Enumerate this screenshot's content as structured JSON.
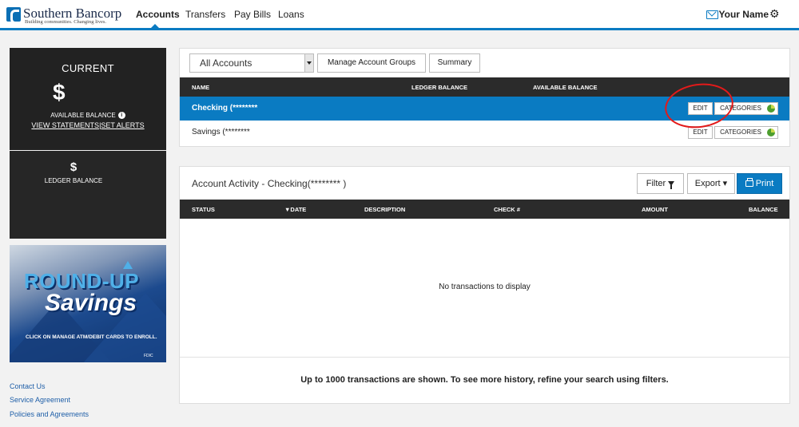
{
  "brand": {
    "name": "Southern Bancorp",
    "tagline": "Building communities. Changing lives."
  },
  "nav": {
    "items": [
      "Accounts",
      "Transfers",
      "Pay Bills",
      "Loans"
    ],
    "active": "Accounts",
    "user_name": "Your Name"
  },
  "sidebar": {
    "current_label": "CURRENT",
    "available_amount": "$",
    "available_label": "AVAILABLE BALANCE",
    "view_statements": "VIEW STATEMENTS",
    "separator": "|",
    "set_alerts": "SET ALERTS",
    "ledger_amount": "$",
    "ledger_label": "LEDGER BALANCE",
    "promo": {
      "title_line1": "ROUND-UP",
      "title_line2": "Savings",
      "cta": "CLICK ON MANAGE ATM/DEBIT CARDS TO ENROLL.",
      "fdic": "FDIC"
    },
    "footer_links": [
      "Contact Us",
      "Service Agreement",
      "Policies and Agreements"
    ]
  },
  "accounts": {
    "filter_select": "All Accounts",
    "manage_groups": "Manage Account Groups",
    "summary": "Summary",
    "columns": [
      "NAME",
      "LEDGER BALANCE",
      "AVAILABLE BALANCE"
    ],
    "rows": [
      {
        "name": "Checking (********",
        "selected": true,
        "edit": "EDIT",
        "categories": "CATEGORIES"
      },
      {
        "name": "Savings (********",
        "selected": false,
        "edit": "EDIT",
        "categories": "CATEGORIES"
      }
    ]
  },
  "activity": {
    "title": "Account Activity - Checking(********        )",
    "filter": "Filter",
    "export": "Export",
    "export_caret": "▾",
    "print": "Print",
    "columns": [
      "STATUS",
      "▼DATE",
      "DESCRIPTION",
      "CHECK #",
      "AMOUNT",
      "BALANCE"
    ],
    "empty_message": "No transactions to display",
    "footer_message": "Up to 1000 transactions are shown. To see more history, refine your search using filters."
  },
  "colors": {
    "accent": "#0a7bc2",
    "header_dark": "#2b2b2b",
    "highlight": "#e31a1a"
  }
}
